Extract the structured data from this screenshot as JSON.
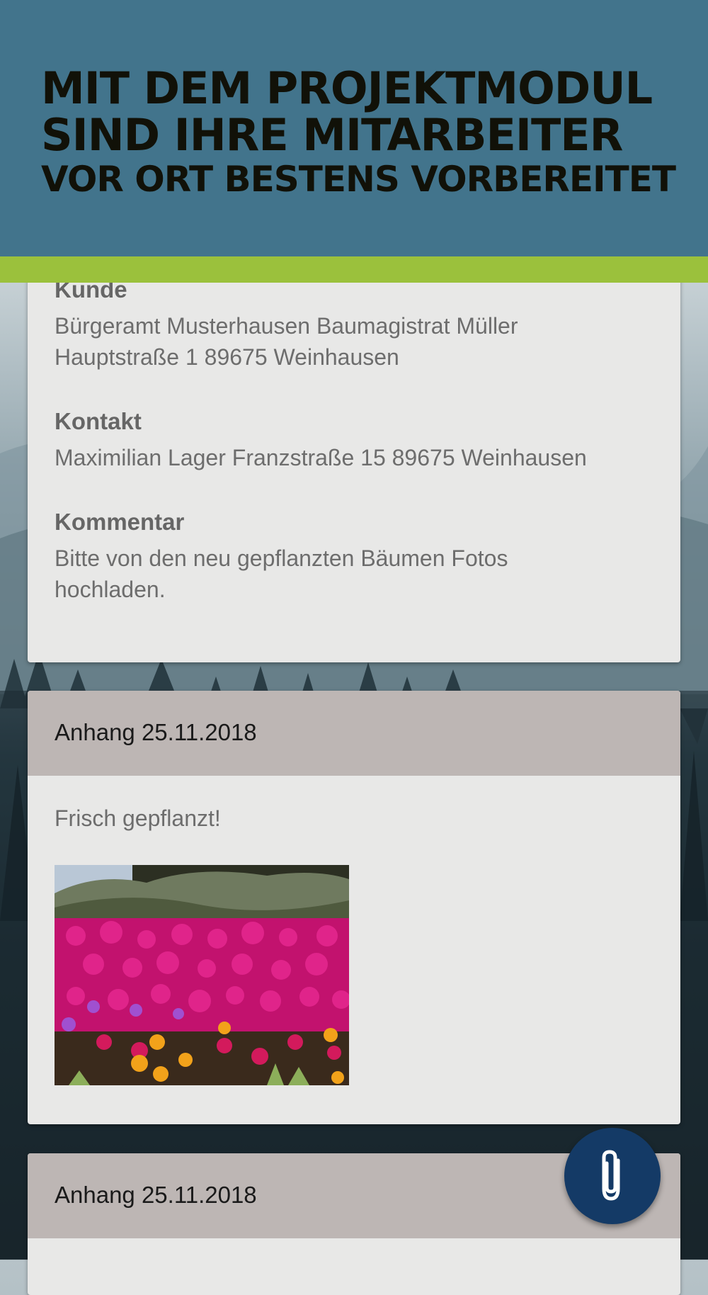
{
  "banner": {
    "line1": "MIT DEM PROJEKTMODUL",
    "line2": "SIND IHRE MITARBEITER",
    "line3": "VOR ORT BESTENS VORBEREITET"
  },
  "details": {
    "customer_label": "Kunde",
    "customer_line1": "Bürgeramt Musterhausen Baumagistrat Müller",
    "customer_line2": "Hauptstraße 1 89675 Weinhausen",
    "contact_label": "Kontakt",
    "contact_value": "Maximilian Lager Franzstraße 15 89675 Weinhausen",
    "comment_label": "Kommentar",
    "comment_line1": "Bitte von den neu gepflanzten Bäumen Fotos",
    "comment_line2": "hochladen."
  },
  "attachments": [
    {
      "title": "Anhang 25.11.2018",
      "caption": "Frisch gepflanzt!"
    },
    {
      "title": "Anhang 25.11.2018"
    }
  ],
  "fab": {
    "icon": "paperclip-icon"
  },
  "colors": {
    "banner": "#42748c",
    "accent": "#9bc13c",
    "card": "#e8e8e7",
    "card_header": "#bdb6b4",
    "fab": "#143a66"
  }
}
